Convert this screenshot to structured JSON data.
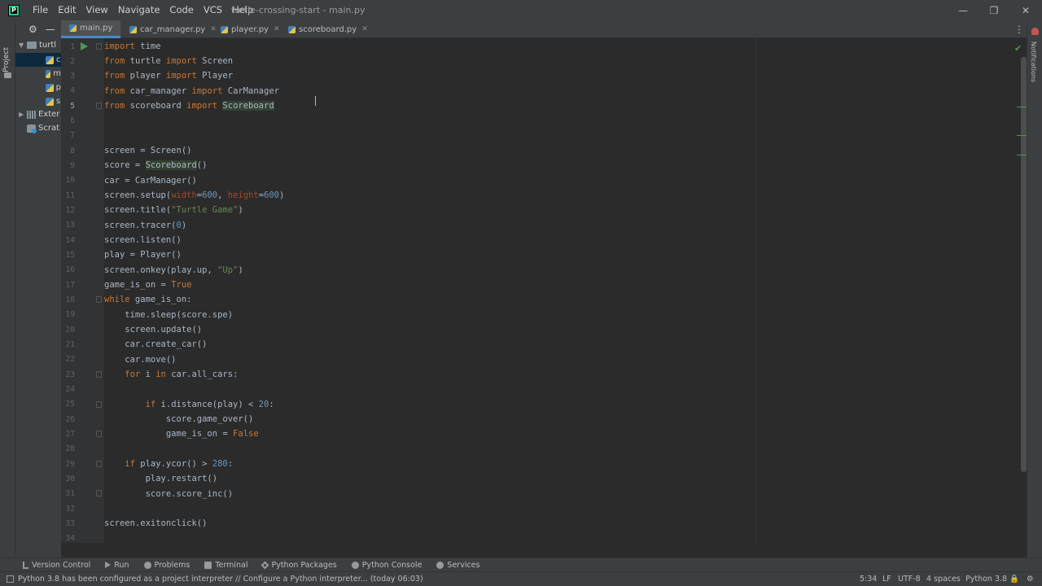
{
  "window": {
    "title": "turtle-crossing-start - main.py",
    "menu": [
      "File",
      "Edit",
      "View",
      "Navigate",
      "Code",
      "VCS",
      "Help"
    ],
    "minimize": "—",
    "restore": "❐",
    "close": "✕"
  },
  "left_stripe": {
    "project_label": "Project"
  },
  "project_panel": {
    "items": [
      {
        "label": "turtl",
        "icon": "folder-icon"
      },
      {
        "label": "c",
        "icon": "python-file-icon"
      },
      {
        "label": "m",
        "icon": "python-file-icon"
      },
      {
        "label": "p",
        "icon": "python-file-icon"
      },
      {
        "label": "s",
        "icon": "python-file-icon"
      },
      {
        "label": "Exter",
        "icon": "libraries-icon"
      },
      {
        "label": "Scrat",
        "icon": "scratches-icon"
      }
    ]
  },
  "tabs": [
    {
      "label": "main.py",
      "active": true
    },
    {
      "label": "car_manager.py",
      "active": false
    },
    {
      "label": "player.py",
      "active": false
    },
    {
      "label": "scoreboard.py",
      "active": false
    }
  ],
  "right_stripe": {
    "notifications_label": "Notifications"
  },
  "editor": {
    "line_numbers": [
      "1",
      "2",
      "3",
      "4",
      "5",
      "6",
      "7",
      "8",
      "9",
      "10",
      "11",
      "12",
      "13",
      "14",
      "15",
      "16",
      "17",
      "18",
      "19",
      "20",
      "21",
      "22",
      "23",
      "24",
      "25",
      "26",
      "27",
      "28",
      "29",
      "30",
      "31",
      "32",
      "33",
      "34"
    ],
    "current_line": "5",
    "code_lines": [
      "import time",
      "from turtle import Screen",
      "from player import Player",
      "from car_manager import CarManager",
      "from scoreboard import Scoreboard",
      "",
      "",
      "screen = Screen()",
      "score = Scoreboard()",
      "car = CarManager()",
      "screen.setup(width=600, height=600)",
      "screen.title(\"Turtle Game\")",
      "screen.tracer(0)",
      "screen.listen()",
      "play = Player()",
      "screen.onkey(play.up, \"Up\")",
      "game_is_on = True",
      "while game_is_on:",
      "    time.sleep(score.spe)",
      "    screen.update()",
      "    car.create_car()",
      "    car.move()",
      "    for i in car.all_cars:",
      "",
      "        if i.distance(play) < 20:",
      "            score.game_over()",
      "            game_is_on = False",
      "",
      "    if play.ycor() > 280:",
      "        play.restart()",
      "        score.score_inc()",
      "",
      "screen.exitonclick()"
    ]
  },
  "tool_windows": [
    {
      "label": "Version Control",
      "icon": "branch-icon"
    },
    {
      "label": "Run",
      "icon": "run-icon"
    },
    {
      "label": "Problems",
      "icon": "problems-icon"
    },
    {
      "label": "Terminal",
      "icon": "terminal-icon"
    },
    {
      "label": "Python Packages",
      "icon": "packages-icon"
    },
    {
      "label": "Python Console",
      "icon": "python-console-icon"
    },
    {
      "label": "Services",
      "icon": "services-icon"
    }
  ],
  "status": {
    "message": "Python 3.8 has been configured as a project interpreter // Configure a Python interpreter... (today 06:03)",
    "position": "5:34",
    "line_separator": "LF",
    "encoding": "UTF-8",
    "indent": "4 spaces",
    "interpreter": "Python 3.8"
  },
  "colors": {
    "background": "#2b2b2b",
    "keyword": "#cc7832",
    "string": "#6a8759",
    "number": "#6897bb",
    "accent": "#4a88c7"
  }
}
